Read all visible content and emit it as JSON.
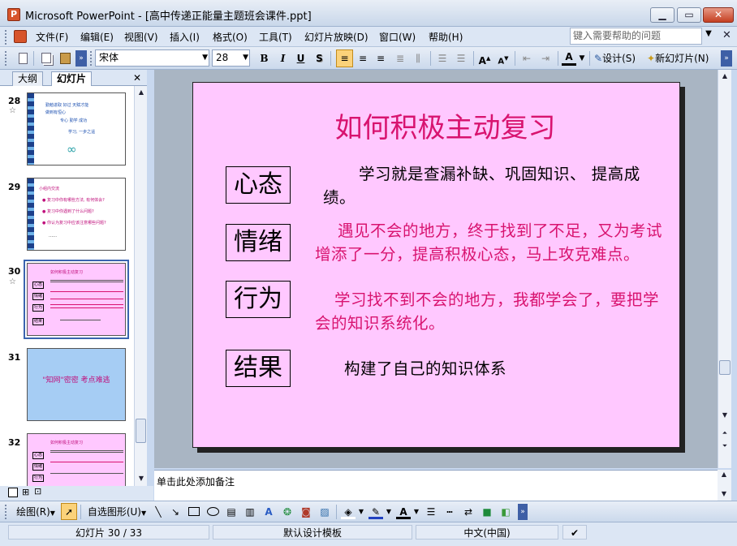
{
  "window": {
    "title": "Microsoft PowerPoint - [高中传递正能量主题班会课件.ppt]",
    "minimize_glyph": "▁",
    "maximize_glyph": "▭",
    "close_glyph": "✕"
  },
  "menu": {
    "items": [
      "文件(F)",
      "编辑(E)",
      "视图(V)",
      "插入(I)",
      "格式(O)",
      "工具(T)",
      "幻灯片放映(D)",
      "窗口(W)",
      "帮助(H)"
    ],
    "help_placeholder": "键入需要帮助的问题",
    "close_glyph": "✕"
  },
  "toolbar": {
    "font_name": "宋体",
    "font_size": "28",
    "bold": "B",
    "italic": "I",
    "underline": "U",
    "shadow": "S",
    "design_label": "设计(S)",
    "new_slide_label": "新幻灯片(N)"
  },
  "panel": {
    "tab_outline": "大纲",
    "tab_slides": "幻灯片",
    "close_glyph": "✕",
    "slides": [
      {
        "num": "28",
        "lines": [
          "勤勉进取 好过 天赋才能",
          "做到有恒心",
          "专心 勤学 成功",
          "学习, 一步之遥"
        ]
      },
      {
        "num": "29",
        "lines": [
          "小组内交流",
          "● 复习中你有哪些方法, 有何体会?",
          "● 复习中你遇到了什么问题?",
          "● 你认为复习中应该注意哪些问题?",
          "……"
        ]
      },
      {
        "num": "30",
        "lines": [
          "如何积极主动复习",
          "心态",
          "情绪",
          "行为",
          "结果"
        ]
      },
      {
        "num": "31",
        "lines": [
          "\"知网\"密密 考点难逃"
        ]
      },
      {
        "num": "32",
        "lines": [
          "如何积极主动复习",
          "心态",
          "情绪",
          "行为"
        ]
      }
    ]
  },
  "slide": {
    "title": "如何积极主动复习",
    "labels": [
      "心态",
      "情绪",
      "行为",
      "结果"
    ],
    "text_xintai": "学习就是查漏补缺、巩固知识、 提高成绩。",
    "text_qingxu": "遇见不会的地方，终于找到了不足，又为考试增添了一分，提高积极心态，马上攻克难点。",
    "text_xingwei": "学习找不到不会的地方，我都学会了，要把学会的知识系统化。",
    "text_jieguo": "构建了自己的知识体系"
  },
  "notes": {
    "placeholder": "单击此处添加备注"
  },
  "drawbar": {
    "draw_label": "绘图(R)",
    "autoshape_label": "自选图形(U)"
  },
  "status": {
    "slide_position": "幻灯片 30 / 33",
    "template": "默认设计模板",
    "language": "中文(中国)"
  },
  "colors": {
    "slide_bg": "#ffc8ff",
    "title": "#d8136f",
    "pink_text": "#d8136f"
  }
}
